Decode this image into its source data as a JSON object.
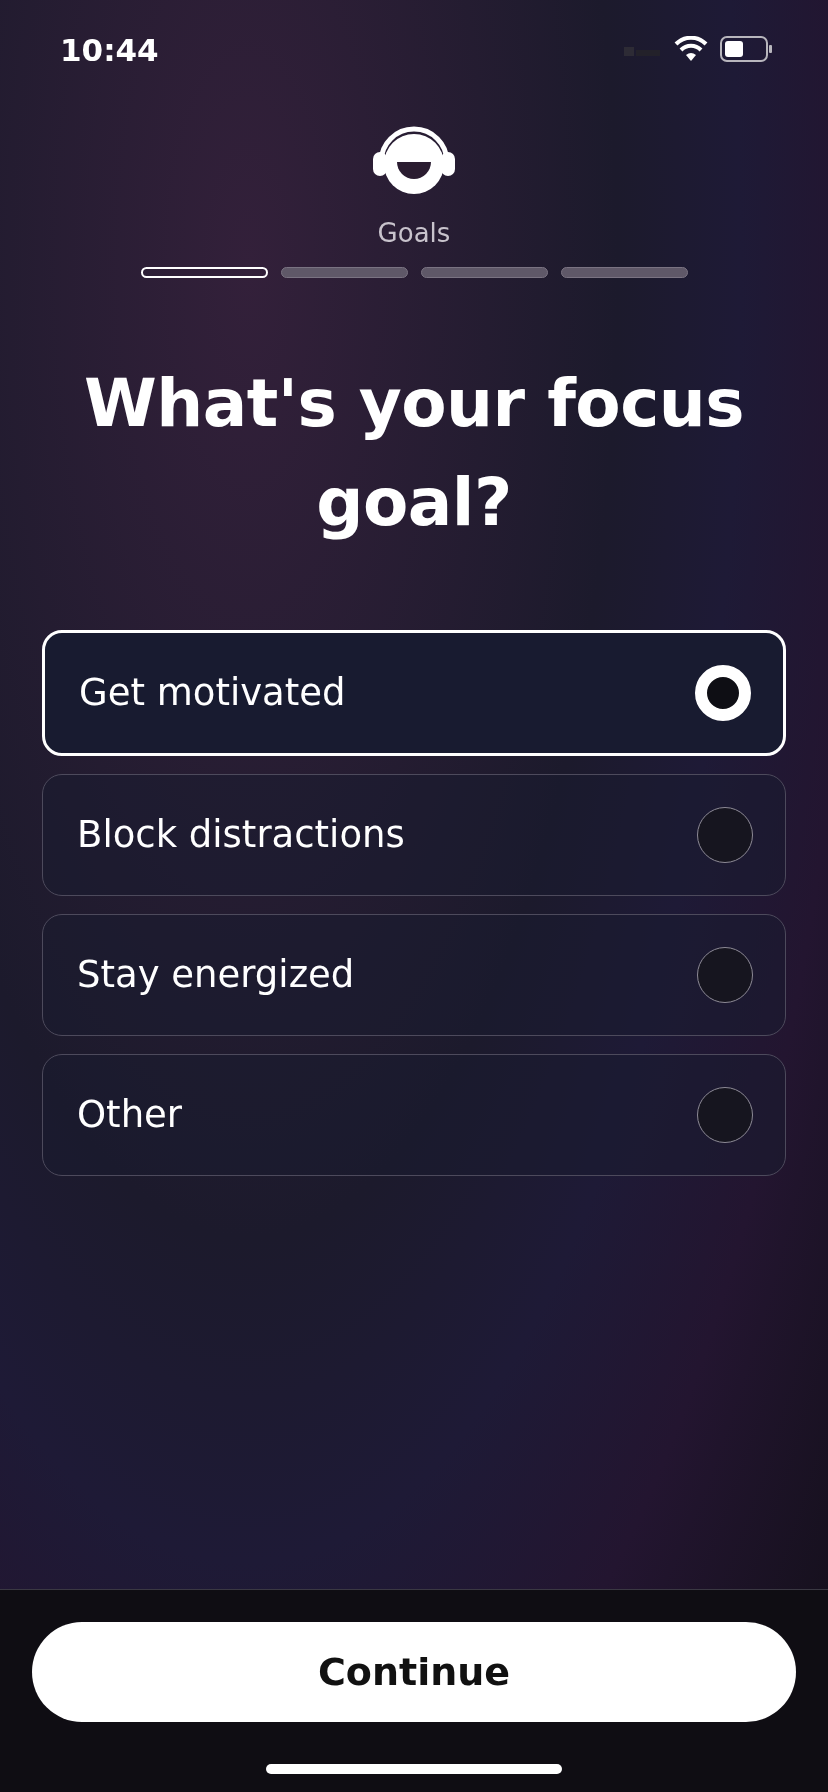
{
  "status_bar": {
    "time": "10:44"
  },
  "header": {
    "step_label": "Goals",
    "steps": [
      {
        "active": true
      },
      {
        "active": false
      },
      {
        "active": false
      },
      {
        "active": false
      }
    ]
  },
  "title": "What's your focus goal?",
  "options": [
    {
      "label": "Get motivated",
      "selected": true
    },
    {
      "label": "Block distractions",
      "selected": false
    },
    {
      "label": "Stay energized",
      "selected": false
    },
    {
      "label": "Other",
      "selected": false
    }
  ],
  "continue_button": {
    "label": "Continue"
  }
}
